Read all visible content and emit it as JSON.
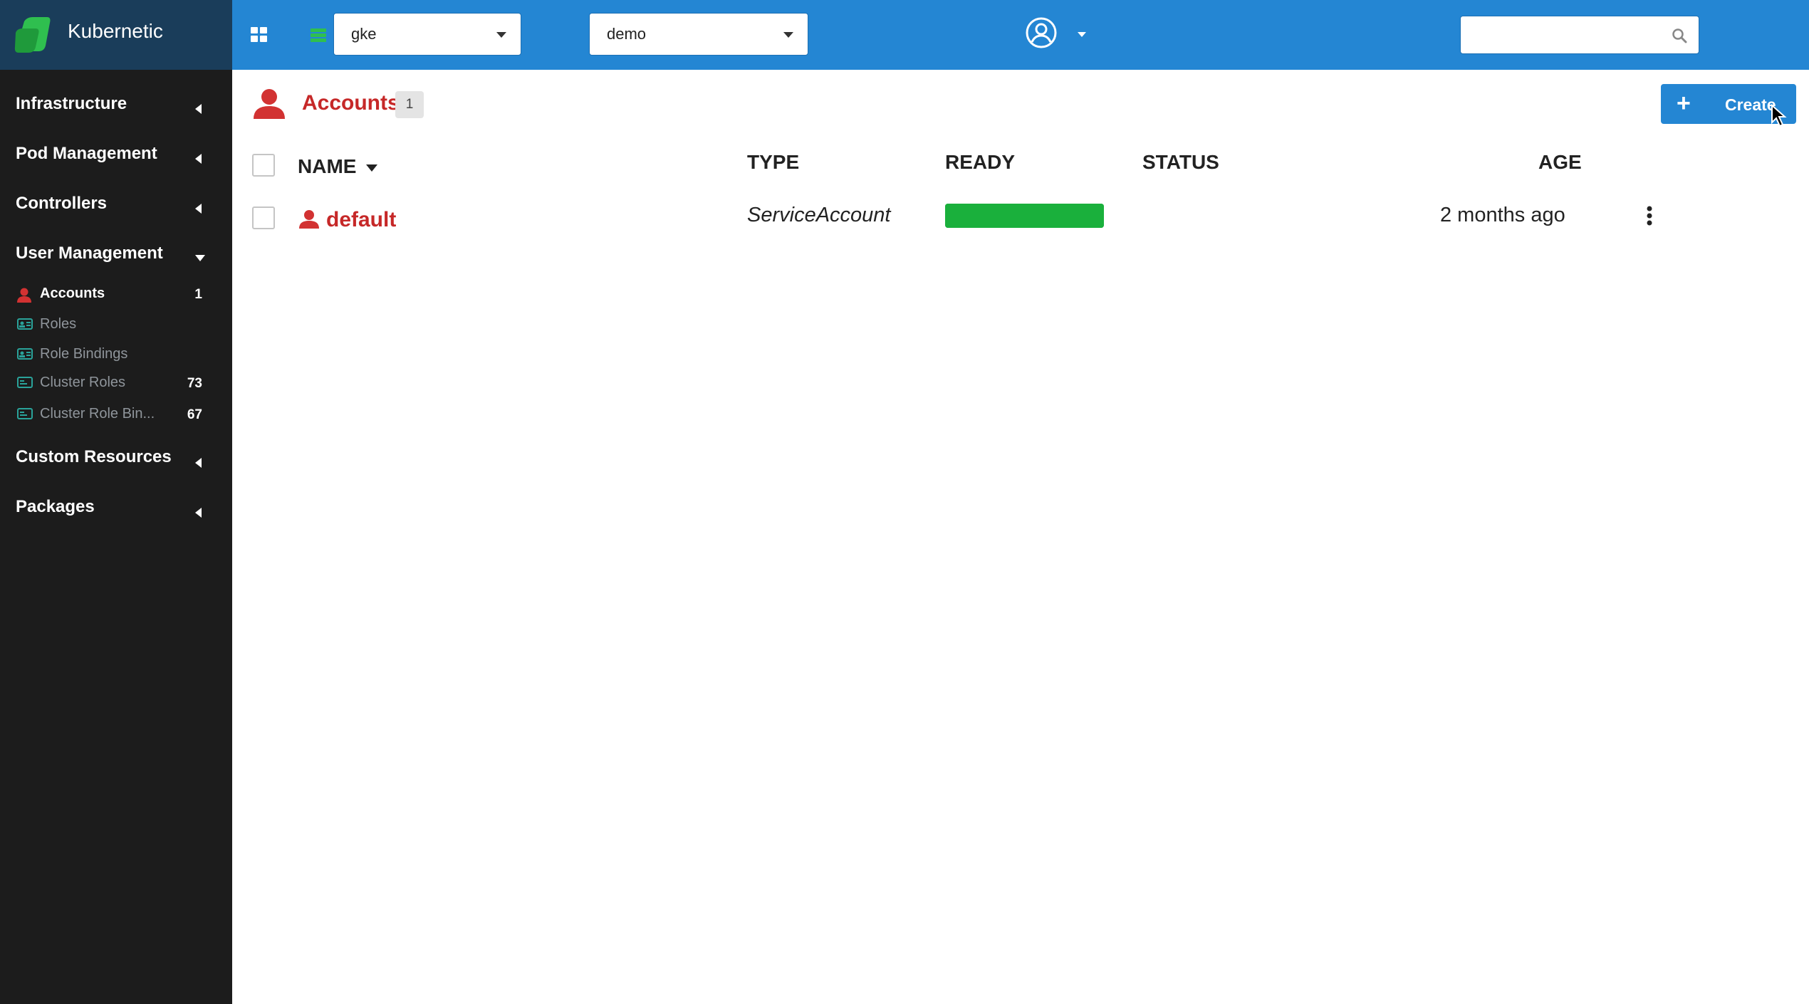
{
  "app": {
    "name": "Kubernetic"
  },
  "topbar": {
    "cluster_value": "gke",
    "namespace_value": "demo",
    "search_placeholder": ""
  },
  "sidebar": {
    "sections": {
      "infrastructure": "Infrastructure",
      "pod_management": "Pod Management",
      "controllers": "Controllers",
      "user_management": "User Management",
      "custom_resources": "Custom Resources",
      "packages": "Packages"
    },
    "user_items": [
      {
        "label": "Accounts",
        "count": "1",
        "active": true,
        "icon": "user-icon"
      },
      {
        "label": "Roles",
        "count": "",
        "icon": "id-card-icon"
      },
      {
        "label": "Role Bindings",
        "count": "",
        "icon": "id-card-icon"
      },
      {
        "label": "Cluster Roles",
        "count": "73",
        "icon": "id-card-icon"
      },
      {
        "label": "Cluster Role Bin...",
        "count": "67",
        "icon": "id-card-icon"
      }
    ]
  },
  "page": {
    "title": "Accounts",
    "count": "1",
    "create_label": "Create"
  },
  "table": {
    "headers": {
      "name": "NAME",
      "type": "TYPE",
      "ready": "READY",
      "status": "STATUS",
      "age": "AGE"
    },
    "rows": [
      {
        "name": "default",
        "type": "ServiceAccount",
        "ready_fraction": 1.0,
        "status": "",
        "age": "2 months ago"
      }
    ]
  },
  "colors": {
    "accent": "#2486d3",
    "sidebar_bg": "#1c1c1c",
    "brand_bg": "#1a3d5a",
    "title_red": "#c62828",
    "ready_green": "#1ab03c",
    "icon_teal": "#2aa39a"
  }
}
